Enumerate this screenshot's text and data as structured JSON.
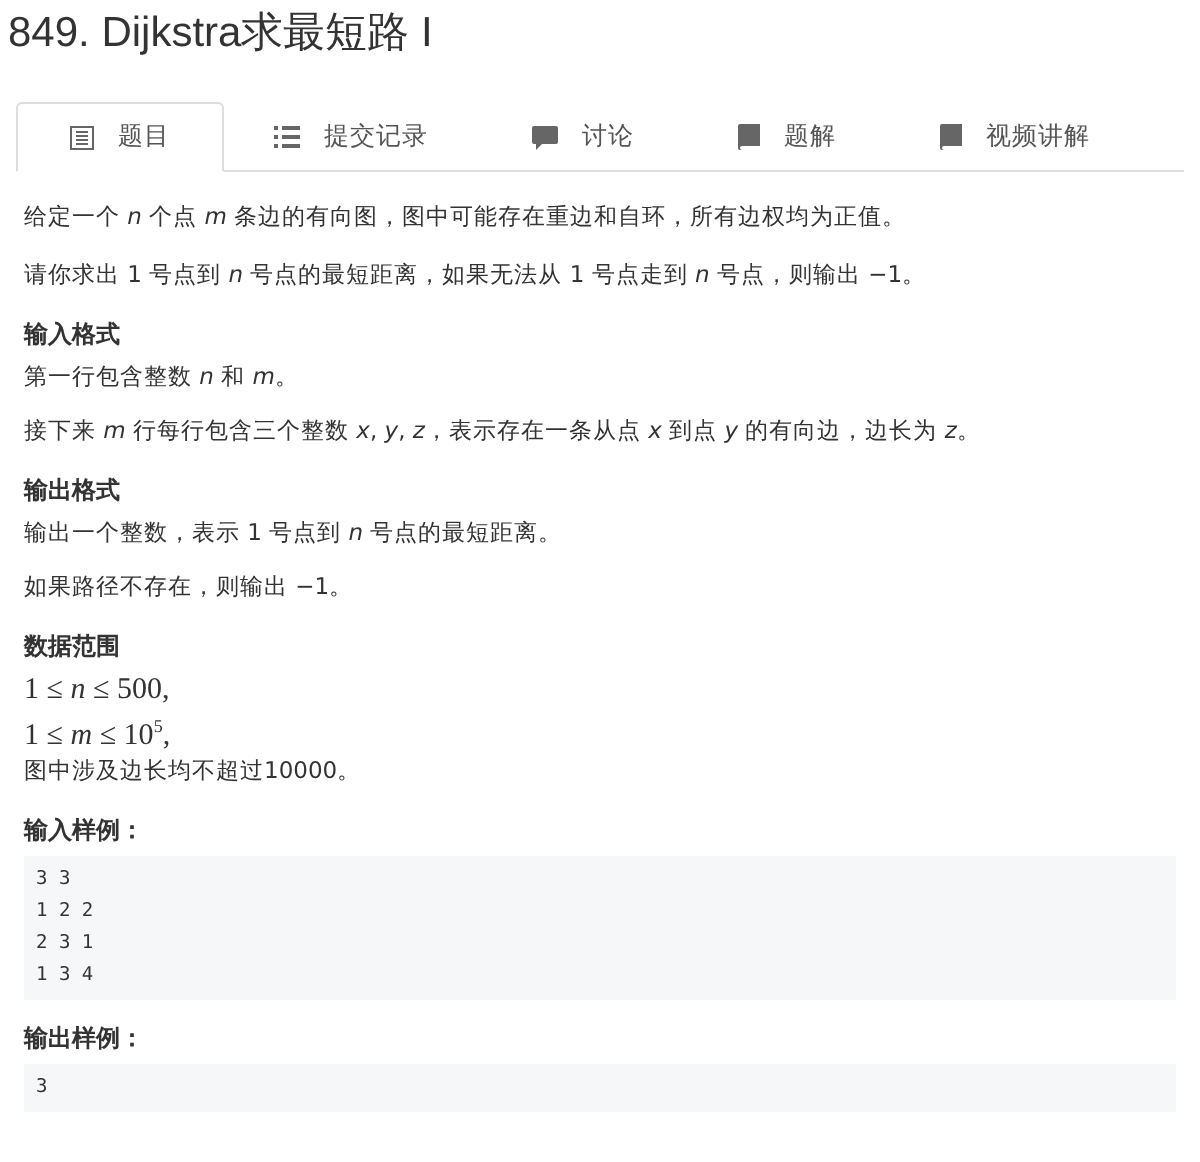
{
  "title": "849. Dijkstra求最短路 I",
  "tabs": [
    {
      "label": "题目",
      "kind": "doc",
      "selected": true
    },
    {
      "label": "提交记录",
      "kind": "list",
      "selected": false
    },
    {
      "label": "讨论",
      "kind": "chat",
      "selected": false
    },
    {
      "label": "题解",
      "kind": "book",
      "selected": false
    },
    {
      "label": "视频讲解",
      "kind": "book",
      "selected": false
    }
  ],
  "blocks": [
    {
      "kind": "paragraph",
      "text": "给定一个 *n* 个点 *m* 条边的有向图，图中可能存在重边和自环，所有边权均为正值。"
    },
    {
      "kind": "paragraph",
      "text": "请你求出 1 号点到 *n* 号点的最短距离，如果无法从 1 号点走到 *n* 号点，则输出 −1。"
    },
    {
      "kind": "heading",
      "text": "输入格式"
    },
    {
      "kind": "line",
      "text": "第一行包含整数 *n* 和 *m*。"
    },
    {
      "kind": "paragraph",
      "text": "接下来 *m* 行每行包含三个整数 *x*, *y*, *z*，表示存在一条从点 *x* 到点 *y* 的有向边，边长为 *z*。"
    },
    {
      "kind": "heading",
      "text": "输出格式"
    },
    {
      "kind": "line",
      "text": "输出一个整数，表示 1 号点到 *n* 号点的最短距离。"
    },
    {
      "kind": "paragraph",
      "text": "如果路径不存在，则输出 −1。"
    },
    {
      "kind": "heading",
      "text": "数据范围"
    },
    {
      "kind": "math",
      "text": "1 ≤ *n* ≤ 500,"
    },
    {
      "kind": "math",
      "text": "1 ≤ *m* ≤ 10$^{5}$,"
    },
    {
      "kind": "paragraph",
      "text": "图中涉及边长均不超过10000。"
    },
    {
      "kind": "heading",
      "text": "输入样例："
    },
    {
      "kind": "code",
      "lines": [
        "3 3",
        "1 2 2",
        "2 3 1",
        "1 3 4"
      ]
    },
    {
      "kind": "heading",
      "text": "输出样例："
    },
    {
      "kind": "code",
      "lines": [
        "3"
      ]
    }
  ]
}
